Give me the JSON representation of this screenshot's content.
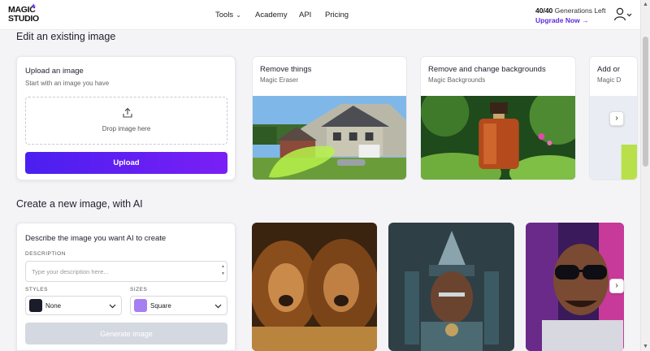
{
  "header": {
    "logo_line1": "MAGIC",
    "logo_line2": "STUDIO",
    "nav": [
      {
        "label": "Tools",
        "has_dropdown": true
      },
      {
        "label": "Academy"
      },
      {
        "label": "API"
      },
      {
        "label": "Pricing"
      }
    ],
    "generations_count": "40/40",
    "generations_label": "Generations Left",
    "upgrade_label": "Upgrade Now",
    "upgrade_arrow": "→"
  },
  "edit_section": {
    "title": "Edit an existing image",
    "upload_panel": {
      "title": "Upload an image",
      "subtitle": "Start with an image you have",
      "drop_text": "Drop image here",
      "button_label": "Upload"
    },
    "cards": [
      {
        "title": "Remove things",
        "subtitle": "Magic Eraser"
      },
      {
        "title": "Remove and change backgrounds",
        "subtitle": "Magic Backgrounds"
      },
      {
        "title": "Add or",
        "subtitle": "Magic D"
      }
    ],
    "next_arrow": "›"
  },
  "create_section": {
    "title": "Create a new image, with AI",
    "panel": {
      "title": "Describe the image you want AI to create",
      "description_label": "DESCRIPTION",
      "description_placeholder": "Type your description here...",
      "description_value": "",
      "styles_label": "STYLES",
      "style_value": "None",
      "sizes_label": "SIZES",
      "size_value": "Square",
      "generate_label": "Generate image"
    },
    "next_arrow": "›"
  },
  "colors": {
    "accent": "#5b2be0",
    "upload_gradient_start": "#4a1ff0",
    "upload_gradient_end": "#7a1ff5",
    "generate_disabled": "#d4d8e0",
    "style_swatch": "#1a1d29",
    "size_swatch": "#a77ef0"
  }
}
